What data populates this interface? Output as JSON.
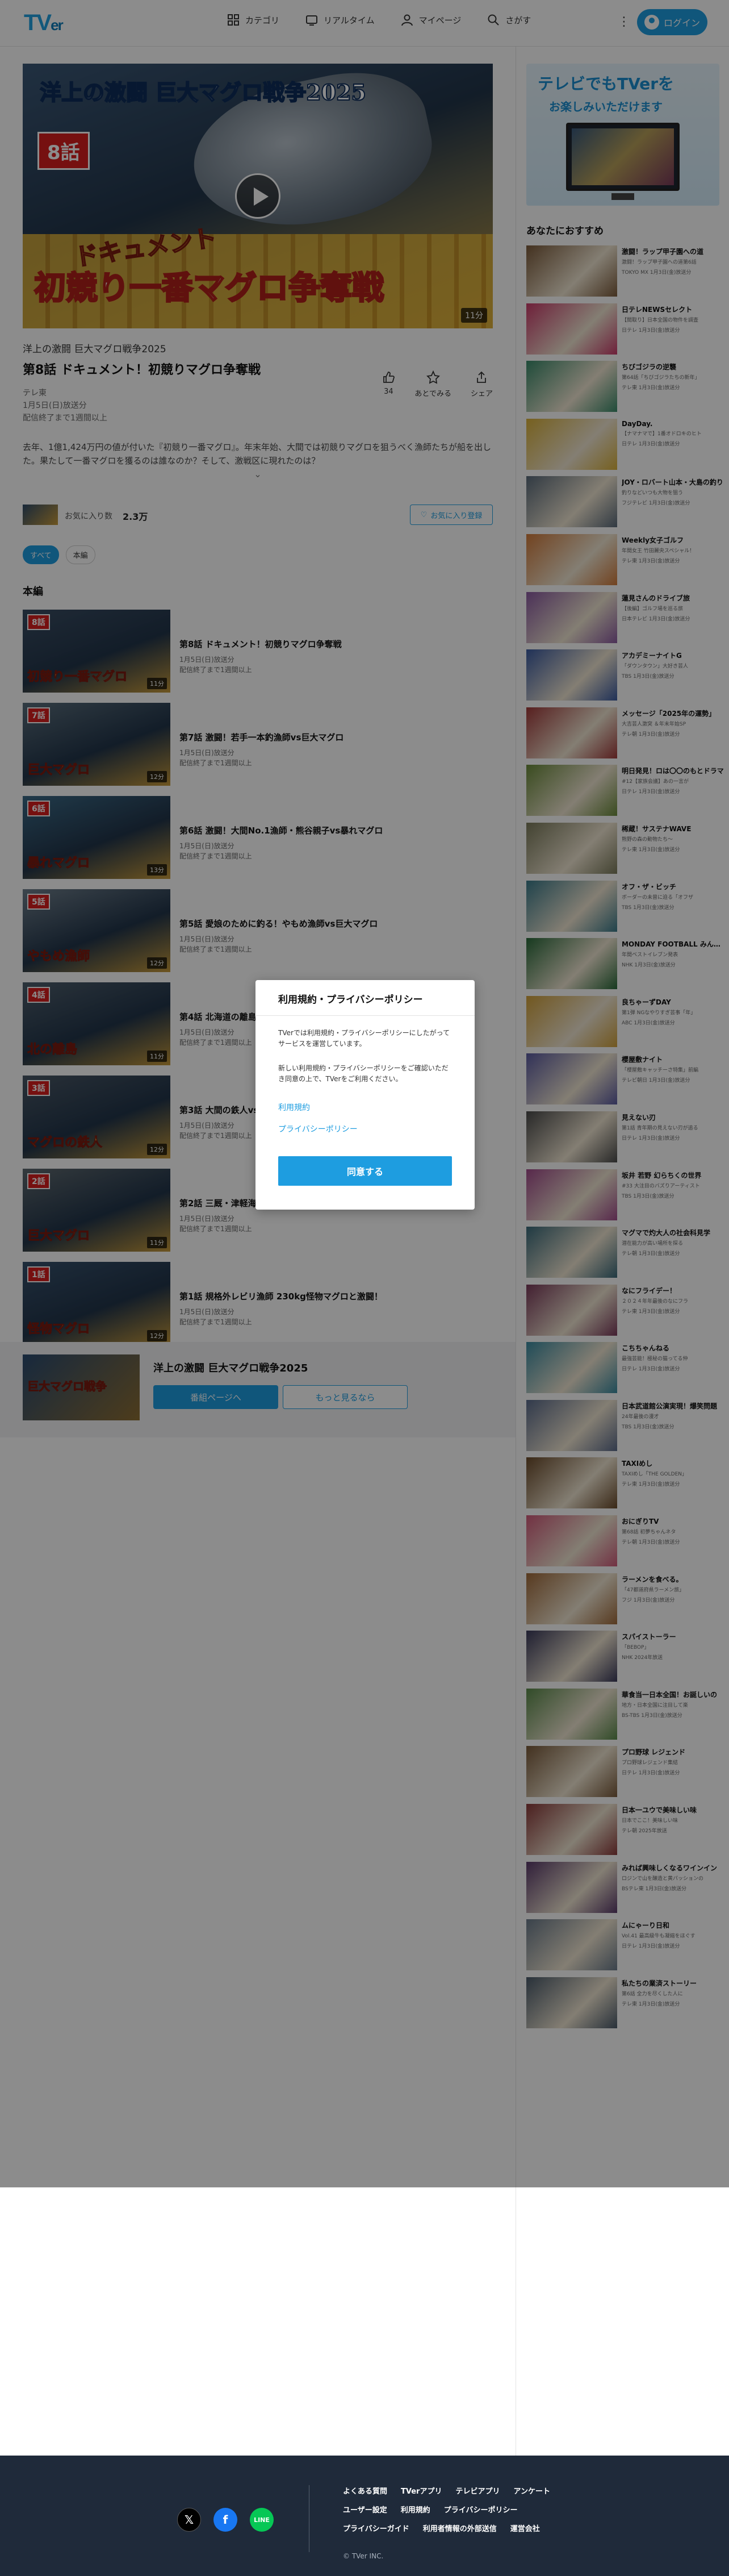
{
  "header": {
    "logo": "TVer",
    "nav": [
      {
        "label": "カテゴリ",
        "icon": "grid-icon"
      },
      {
        "label": "リアルタイム",
        "icon": "tv-icon"
      },
      {
        "label": "マイページ",
        "icon": "user-icon"
      },
      {
        "label": "さがす",
        "icon": "search-icon"
      }
    ],
    "login_label": "ログイン"
  },
  "player": {
    "series_logo": "洋上の激闘 巨大マグロ戦争2025",
    "episode_badge": "8話",
    "doc_title": "ドキュメント",
    "big_title": "初競り一番マグロ争奪戦",
    "duration": "11分"
  },
  "episode": {
    "series": "洋上の激闘 巨大マグロ戦争2025",
    "title": "第8話 ドキュメント！初競りマグロ争奪戦",
    "broadcaster": "テレ東",
    "air": "1月5日(日)放送分",
    "expiry": "配信終了まで1週間以上",
    "actions": [
      {
        "label": "34",
        "icon": "thumb-up-icon"
      },
      {
        "label": "あとでみる",
        "icon": "later-icon"
      },
      {
        "label": "シェア",
        "icon": "share-icon"
      }
    ],
    "description": "去年、1億1,424万円の値が付いた『初競り一番マグロ』。年末年始、大間では初競りマグロを狙うべく漁師たちが船を出した。果たして一番マグロを獲るのは誰なのか？そして、激戦区に現れたのは？",
    "fav_label": "お気に入り数",
    "fav_count": "2.3万",
    "fav_button": "お気に入り登録"
  },
  "chips": [
    "すべて",
    "本編"
  ],
  "section_title": "本編",
  "episodes": [
    {
      "name": "第8話 ドキュメント！初競りマグロ争奪戦",
      "air": "1月5日(日)放送分",
      "expiry": "配信終了まで1週間以上",
      "thumb_text": "初競り一番マグロ",
      "badge": "8話",
      "dur": "11分",
      "bg": "#3a4d63"
    },
    {
      "name": "第7話 激闘！若手一本釣漁師vs巨大マグロ",
      "air": "1月5日(日)放送分",
      "expiry": "配信終了まで1週間以上",
      "thumb_text": "巨大マグロ",
      "badge": "7話",
      "dur": "12分",
      "bg": "#5a6e7c"
    },
    {
      "name": "第6話 激闘！大間No.1漁師・熊谷親子vs暴れマグロ",
      "air": "1月5日(日)放送分",
      "expiry": "配信終了まで1週間以上",
      "thumb_text": "暴れマグロ",
      "badge": "6話",
      "dur": "13分",
      "bg": "#3b6a87"
    },
    {
      "name": "第5話 愛娘のために釣る！やもめ漁師vs巨大マグロ",
      "air": "1月5日(日)放送分",
      "expiry": "配信終了まで1週間以上",
      "thumb_text": "やもめ漁師",
      "badge": "5話",
      "dur": "12分",
      "bg": "#6f7f8c"
    },
    {
      "name": "第4話 北海道の離島で大物マグロ狙い",
      "air": "1月5日(日)放送分",
      "expiry": "配信終了まで1週間以上",
      "thumb_text": "北の離島",
      "badge": "4話",
      "dur": "11分",
      "bg": "#4f5f6d"
    },
    {
      "name": "第3話 大間の鉄人vs巨大マグロ",
      "air": "1月5日(日)放送分",
      "expiry": "配信終了まで1週間以上",
      "thumb_text": "マグロの鉄人",
      "badge": "3話",
      "dur": "12分",
      "bg": "#4a5866"
    },
    {
      "name": "第2話 三厩・津軽海峡の巨大マグロ",
      "air": "1月5日(日)放送分",
      "expiry": "配信終了まで1週間以上",
      "thumb_text": "巨大マグロ",
      "badge": "2話",
      "dur": "11分",
      "bg": "#5f6a70"
    },
    {
      "name": "第1話 規格外レビリ漁師 230kg怪物マグロと激闘！",
      "air": "1月5日(日)放送分",
      "expiry": "配信終了まで1週間以上",
      "thumb_text": "怪物マグロ",
      "badge": "1話",
      "dur": "12分",
      "bg": "#37516d"
    }
  ],
  "series_banner": {
    "title": "洋上の激闘 巨大マグロ戦争2025",
    "thumb_text": "巨大マグロ戦争",
    "btn_primary": "番組ページへ",
    "btn_secondary": "もっと見るなら"
  },
  "sidebar": {
    "promo_line1": "テレビでもTVerを",
    "promo_line2": "お楽しみいただけます",
    "rec_title": "あなたにおすすめ",
    "items": [
      {
        "name": "激闘！ラップ甲子園への道",
        "sub1": "激闘！ラップ甲子園への道第6話",
        "sub2": "TOKYO MX 1月3日(金)放送分",
        "c": "#7b5a3a"
      },
      {
        "name": "日テレNEWSセレクト",
        "sub1": "【間取り】日本全国の物件を調査",
        "sub2": "日テレ 1月3日(金)放送分",
        "c": "#c93b6a"
      },
      {
        "name": "ちびゴジラの逆襲",
        "sub1": "第64話「ちびゴジラたちの新年」",
        "sub2": "テレ東 1月3日(金)放送分",
        "c": "#3a8a6a"
      },
      {
        "name": "DayDay.",
        "sub1": "【ナマナマで】1番オドロキのヒト",
        "sub2": "日テレ 1月3日(金)放送分",
        "c": "#d8b03a"
      },
      {
        "name": "JOY・ロバート山本・大島の釣り",
        "sub1": "釣りなどいつも大物を狙う",
        "sub2": "フジテレビ 1月3日(金)放送分",
        "c": "#5a6a7a"
      },
      {
        "name": "Weekly女子ゴルフ",
        "sub1": "年間女王 竹田麗央スペシャル！",
        "sub2": "テレ東 1月3日(金)放送分",
        "c": "#d07a3a"
      },
      {
        "name": "蓮見さんのドライブ旅",
        "sub1": "【後編】ゴルフ場を巡る旅",
        "sub2": "日本テレビ 1月3日(金)放送分",
        "c": "#8a5aa0"
      },
      {
        "name": "アカデミーナイトG",
        "sub1": "「ダウンタウン」大好き芸人",
        "sub2": "TBS 1月3日(金)放送分",
        "c": "#3a5aa0"
      },
      {
        "name": "メッセージ「2025年の運勢」",
        "sub1": "大吉芸人激突 ＆年末年始SP",
        "sub2": "テレ朝 1月3日(金)放送分",
        "c": "#a03a3a"
      },
      {
        "name": "明日発見！ロは〇〇のもとドラマ",
        "sub1": "#12【家族会議】あの一言が",
        "sub2": "日テレ 1月3日(金)放送分",
        "c": "#6a8a3a"
      },
      {
        "name": "稀蔵！サステナWAVE",
        "sub1": "熊野の森の動物たち〜",
        "sub2": "テレ東 1月3日(金)放送分",
        "c": "#7a7a5a"
      },
      {
        "name": "オフ・ザ・ビッチ",
        "sub1": "ボーダーの未曾に迫る「オフザ",
        "sub2": "TBS 1月3日(金)放送分",
        "c": "#3a7a8a"
      },
      {
        "name": "MONDAY FOOTBALL みんなのJ",
        "sub1": "年間ベストイレブン発表",
        "sub2": "NHK 1月3日(金)放送分",
        "c": "#2a6a3a"
      },
      {
        "name": "良ちゃーずDAY",
        "sub1": "第1弾 NGなやりすぎ芸事「年」",
        "sub2": "ABC 1月3日(金)放送分",
        "c": "#d0a03a"
      },
      {
        "name": "櫻屋敷ナイト",
        "sub1": "「櫻屋敷キャッチーさ特集」前編",
        "sub2": "テレビ朝日 1月3日(金)放送分",
        "c": "#5a5aa0"
      },
      {
        "name": "見えない刃",
        "sub1": "第1話 青年期の見えない刃が追る",
        "sub2": "日テレ 1月3日(金)放送分",
        "c": "#4a4a4a"
      },
      {
        "name": "坂井 若野 幻らちくの世界",
        "sub1": "#33 大注目のバズりアーティスト",
        "sub2": "TBS 1月3日(金)放送分",
        "c": "#a04a8a"
      },
      {
        "name": "マグマで灼大人の社会科見学",
        "sub1": "潜在能力が高い場所を探る",
        "sub2": "テレ朝 1月3日(金)放送分",
        "c": "#3a6a7a"
      },
      {
        "name": "なにフライデー！",
        "sub1": "２０２４年年最後のなにフラ",
        "sub2": "テレ東 1月3日(金)放送分",
        "c": "#7a3a5a"
      },
      {
        "name": "こちちゃんねる",
        "sub1": "最強芸能！極秘の猫ってる仲",
        "sub2": "日テレ 1月3日(金)放送分",
        "c": "#3a8aa0"
      },
      {
        "name": "日本武道館公演実現！爆笑問題",
        "sub1": "24年最後の漫才",
        "sub2": "TBS 1月3日(金)放送分",
        "c": "#5a6a8a"
      },
      {
        "name": "TAXIめし",
        "sub1": "TAXIめし「THE GOLDEN」",
        "sub2": "テレ東 1月3日(金)放送分",
        "c": "#6a4a2a"
      },
      {
        "name": "おにぎりTV",
        "sub1": "第68話 初夢ちゃんネタ",
        "sub2": "テレ朝 1月3日(金)放送分",
        "c": "#d05a7a"
      },
      {
        "name": "ラーメンを食べる。",
        "sub1": "「47都道府県ラーメン旅」",
        "sub2": "フジ 1月3日(金)放送分",
        "c": "#a06a3a"
      },
      {
        "name": "スパイストーラー",
        "sub1": "「BEBOP」",
        "sub2": "NHK 2024年放送",
        "c": "#3a3a5a"
      },
      {
        "name": "華食当一日本全国！お誕しいの",
        "sub1": "地方・日本全国に注目して楽",
        "sub2": "BS-TBS 1月3日(金)放送分",
        "c": "#5a8a4a"
      },
      {
        "name": "プロ野球 レジェンド",
        "sub1": "プロ野球レジェンド集結",
        "sub2": "日テレ 1月3日(金)放送分",
        "c": "#7a5a3a"
      },
      {
        "name": "日本一ユウで美味しい味",
        "sub1": "日本でここ！美味しい味",
        "sub2": "テレ朝 2025年放送",
        "c": "#8a3a3a"
      },
      {
        "name": "みれば興味しくなるワインイン",
        "sub1": "ロジンで山を醸造と黄パッションの",
        "sub2": "BSテレ東 1月3日(金)放送分",
        "c": "#5a3a6a"
      },
      {
        "name": "ムにゃーり日和",
        "sub1": "Vol.41 最高級牛も凝縮をほぐす",
        "sub2": "日テレ 1月3日(金)放送分",
        "c": "#6a7a8a"
      },
      {
        "name": "私たちの業済ストーリー",
        "sub1": "第6話 全力を尽くした人に",
        "sub2": "テレ東 1月3日(金)放送分",
        "c": "#4a5a6a"
      }
    ]
  },
  "modal": {
    "title": "利用規約・プライバシーポリシー",
    "p1": "TVerでは利用規約・プライバシーポリシーにしたがってサービスを運営しています。",
    "p2": "新しい利用規約・プライバシーポリシーをご確認いただき同意の上で、TVerをご利用ください。",
    "link_terms": "利用規約",
    "link_privacy": "プライバシーポリシー",
    "agree": "同意する"
  },
  "footer": {
    "social": [
      {
        "name": "x-icon",
        "glyph": "𝕏"
      },
      {
        "name": "facebook-icon",
        "glyph": "f"
      },
      {
        "name": "line-icon",
        "glyph": "LINE"
      }
    ],
    "rows": [
      [
        "よくある質問",
        "TVerアプリ",
        "テレビアプリ",
        "アンケート"
      ],
      [
        "ユーザー設定",
        "利用規約",
        "プライバシーポリシー"
      ],
      [
        "プライバシーガイド",
        "利用者情報の外部送信",
        "運営会社"
      ]
    ],
    "copyright": "© TVer INC."
  }
}
